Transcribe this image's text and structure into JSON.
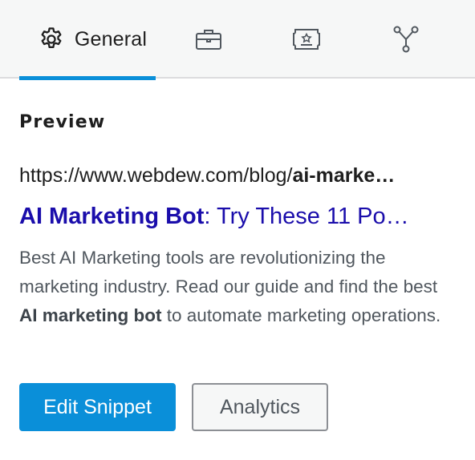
{
  "tabs": [
    {
      "label": "General",
      "icon": "gear-icon",
      "active": true
    },
    {
      "icon": "briefcase-icon"
    },
    {
      "icon": "certificate-icon"
    },
    {
      "icon": "network-icon"
    }
  ],
  "accent_color": "#0a8fd9",
  "preview": {
    "heading": "Preview",
    "url_prefix": "https://www.webdew.com/blog/",
    "url_slug": "ai-marke…",
    "title_bold": "AI Marketing Bot",
    "title_rest": ": Try These 11 Po…",
    "title_color": "#1a0dab",
    "desc_part1": "Best AI Marketing tools are revolutionizing the marketing industry. Read our guide and find the best ",
    "desc_bold": "AI marketing bot",
    "desc_part2": " to automate marketing operations."
  },
  "buttons": {
    "edit_snippet": "Edit Snippet",
    "analytics": "Analytics"
  }
}
